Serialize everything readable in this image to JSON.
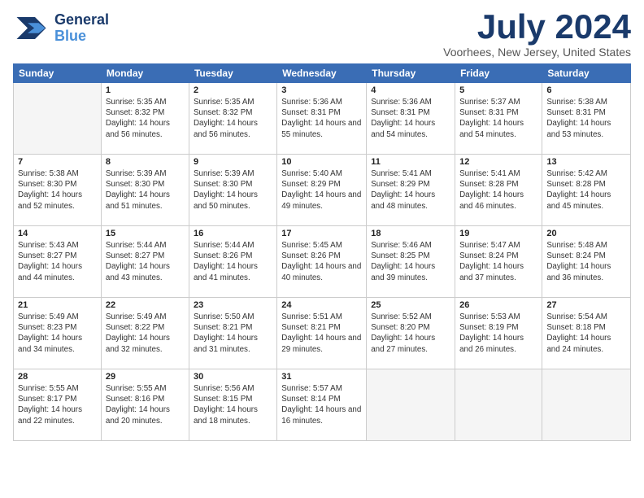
{
  "header": {
    "logo": {
      "line1": "General",
      "line2": "Blue"
    },
    "title": "July 2024",
    "location": "Voorhees, New Jersey, United States"
  },
  "days_of_week": [
    "Sunday",
    "Monday",
    "Tuesday",
    "Wednesday",
    "Thursday",
    "Friday",
    "Saturday"
  ],
  "weeks": [
    [
      {
        "day": "",
        "empty": true
      },
      {
        "day": "1",
        "sunrise": "Sunrise: 5:35 AM",
        "sunset": "Sunset: 8:32 PM",
        "daylight": "Daylight: 14 hours and 56 minutes."
      },
      {
        "day": "2",
        "sunrise": "Sunrise: 5:35 AM",
        "sunset": "Sunset: 8:32 PM",
        "daylight": "Daylight: 14 hours and 56 minutes."
      },
      {
        "day": "3",
        "sunrise": "Sunrise: 5:36 AM",
        "sunset": "Sunset: 8:31 PM",
        "daylight": "Daylight: 14 hours and 55 minutes."
      },
      {
        "day": "4",
        "sunrise": "Sunrise: 5:36 AM",
        "sunset": "Sunset: 8:31 PM",
        "daylight": "Daylight: 14 hours and 54 minutes."
      },
      {
        "day": "5",
        "sunrise": "Sunrise: 5:37 AM",
        "sunset": "Sunset: 8:31 PM",
        "daylight": "Daylight: 14 hours and 54 minutes."
      },
      {
        "day": "6",
        "sunrise": "Sunrise: 5:38 AM",
        "sunset": "Sunset: 8:31 PM",
        "daylight": "Daylight: 14 hours and 53 minutes."
      }
    ],
    [
      {
        "day": "7",
        "sunrise": "Sunrise: 5:38 AM",
        "sunset": "Sunset: 8:30 PM",
        "daylight": "Daylight: 14 hours and 52 minutes."
      },
      {
        "day": "8",
        "sunrise": "Sunrise: 5:39 AM",
        "sunset": "Sunset: 8:30 PM",
        "daylight": "Daylight: 14 hours and 51 minutes."
      },
      {
        "day": "9",
        "sunrise": "Sunrise: 5:39 AM",
        "sunset": "Sunset: 8:30 PM",
        "daylight": "Daylight: 14 hours and 50 minutes."
      },
      {
        "day": "10",
        "sunrise": "Sunrise: 5:40 AM",
        "sunset": "Sunset: 8:29 PM",
        "daylight": "Daylight: 14 hours and 49 minutes."
      },
      {
        "day": "11",
        "sunrise": "Sunrise: 5:41 AM",
        "sunset": "Sunset: 8:29 PM",
        "daylight": "Daylight: 14 hours and 48 minutes."
      },
      {
        "day": "12",
        "sunrise": "Sunrise: 5:41 AM",
        "sunset": "Sunset: 8:28 PM",
        "daylight": "Daylight: 14 hours and 46 minutes."
      },
      {
        "day": "13",
        "sunrise": "Sunrise: 5:42 AM",
        "sunset": "Sunset: 8:28 PM",
        "daylight": "Daylight: 14 hours and 45 minutes."
      }
    ],
    [
      {
        "day": "14",
        "sunrise": "Sunrise: 5:43 AM",
        "sunset": "Sunset: 8:27 PM",
        "daylight": "Daylight: 14 hours and 44 minutes."
      },
      {
        "day": "15",
        "sunrise": "Sunrise: 5:44 AM",
        "sunset": "Sunset: 8:27 PM",
        "daylight": "Daylight: 14 hours and 43 minutes."
      },
      {
        "day": "16",
        "sunrise": "Sunrise: 5:44 AM",
        "sunset": "Sunset: 8:26 PM",
        "daylight": "Daylight: 14 hours and 41 minutes."
      },
      {
        "day": "17",
        "sunrise": "Sunrise: 5:45 AM",
        "sunset": "Sunset: 8:26 PM",
        "daylight": "Daylight: 14 hours and 40 minutes."
      },
      {
        "day": "18",
        "sunrise": "Sunrise: 5:46 AM",
        "sunset": "Sunset: 8:25 PM",
        "daylight": "Daylight: 14 hours and 39 minutes."
      },
      {
        "day": "19",
        "sunrise": "Sunrise: 5:47 AM",
        "sunset": "Sunset: 8:24 PM",
        "daylight": "Daylight: 14 hours and 37 minutes."
      },
      {
        "day": "20",
        "sunrise": "Sunrise: 5:48 AM",
        "sunset": "Sunset: 8:24 PM",
        "daylight": "Daylight: 14 hours and 36 minutes."
      }
    ],
    [
      {
        "day": "21",
        "sunrise": "Sunrise: 5:49 AM",
        "sunset": "Sunset: 8:23 PM",
        "daylight": "Daylight: 14 hours and 34 minutes."
      },
      {
        "day": "22",
        "sunrise": "Sunrise: 5:49 AM",
        "sunset": "Sunset: 8:22 PM",
        "daylight": "Daylight: 14 hours and 32 minutes."
      },
      {
        "day": "23",
        "sunrise": "Sunrise: 5:50 AM",
        "sunset": "Sunset: 8:21 PM",
        "daylight": "Daylight: 14 hours and 31 minutes."
      },
      {
        "day": "24",
        "sunrise": "Sunrise: 5:51 AM",
        "sunset": "Sunset: 8:21 PM",
        "daylight": "Daylight: 14 hours and 29 minutes."
      },
      {
        "day": "25",
        "sunrise": "Sunrise: 5:52 AM",
        "sunset": "Sunset: 8:20 PM",
        "daylight": "Daylight: 14 hours and 27 minutes."
      },
      {
        "day": "26",
        "sunrise": "Sunrise: 5:53 AM",
        "sunset": "Sunset: 8:19 PM",
        "daylight": "Daylight: 14 hours and 26 minutes."
      },
      {
        "day": "27",
        "sunrise": "Sunrise: 5:54 AM",
        "sunset": "Sunset: 8:18 PM",
        "daylight": "Daylight: 14 hours and 24 minutes."
      }
    ],
    [
      {
        "day": "28",
        "sunrise": "Sunrise: 5:55 AM",
        "sunset": "Sunset: 8:17 PM",
        "daylight": "Daylight: 14 hours and 22 minutes."
      },
      {
        "day": "29",
        "sunrise": "Sunrise: 5:55 AM",
        "sunset": "Sunset: 8:16 PM",
        "daylight": "Daylight: 14 hours and 20 minutes."
      },
      {
        "day": "30",
        "sunrise": "Sunrise: 5:56 AM",
        "sunset": "Sunset: 8:15 PM",
        "daylight": "Daylight: 14 hours and 18 minutes."
      },
      {
        "day": "31",
        "sunrise": "Sunrise: 5:57 AM",
        "sunset": "Sunset: 8:14 PM",
        "daylight": "Daylight: 14 hours and 16 minutes."
      },
      {
        "day": "",
        "empty": true
      },
      {
        "day": "",
        "empty": true
      },
      {
        "day": "",
        "empty": true
      }
    ]
  ]
}
